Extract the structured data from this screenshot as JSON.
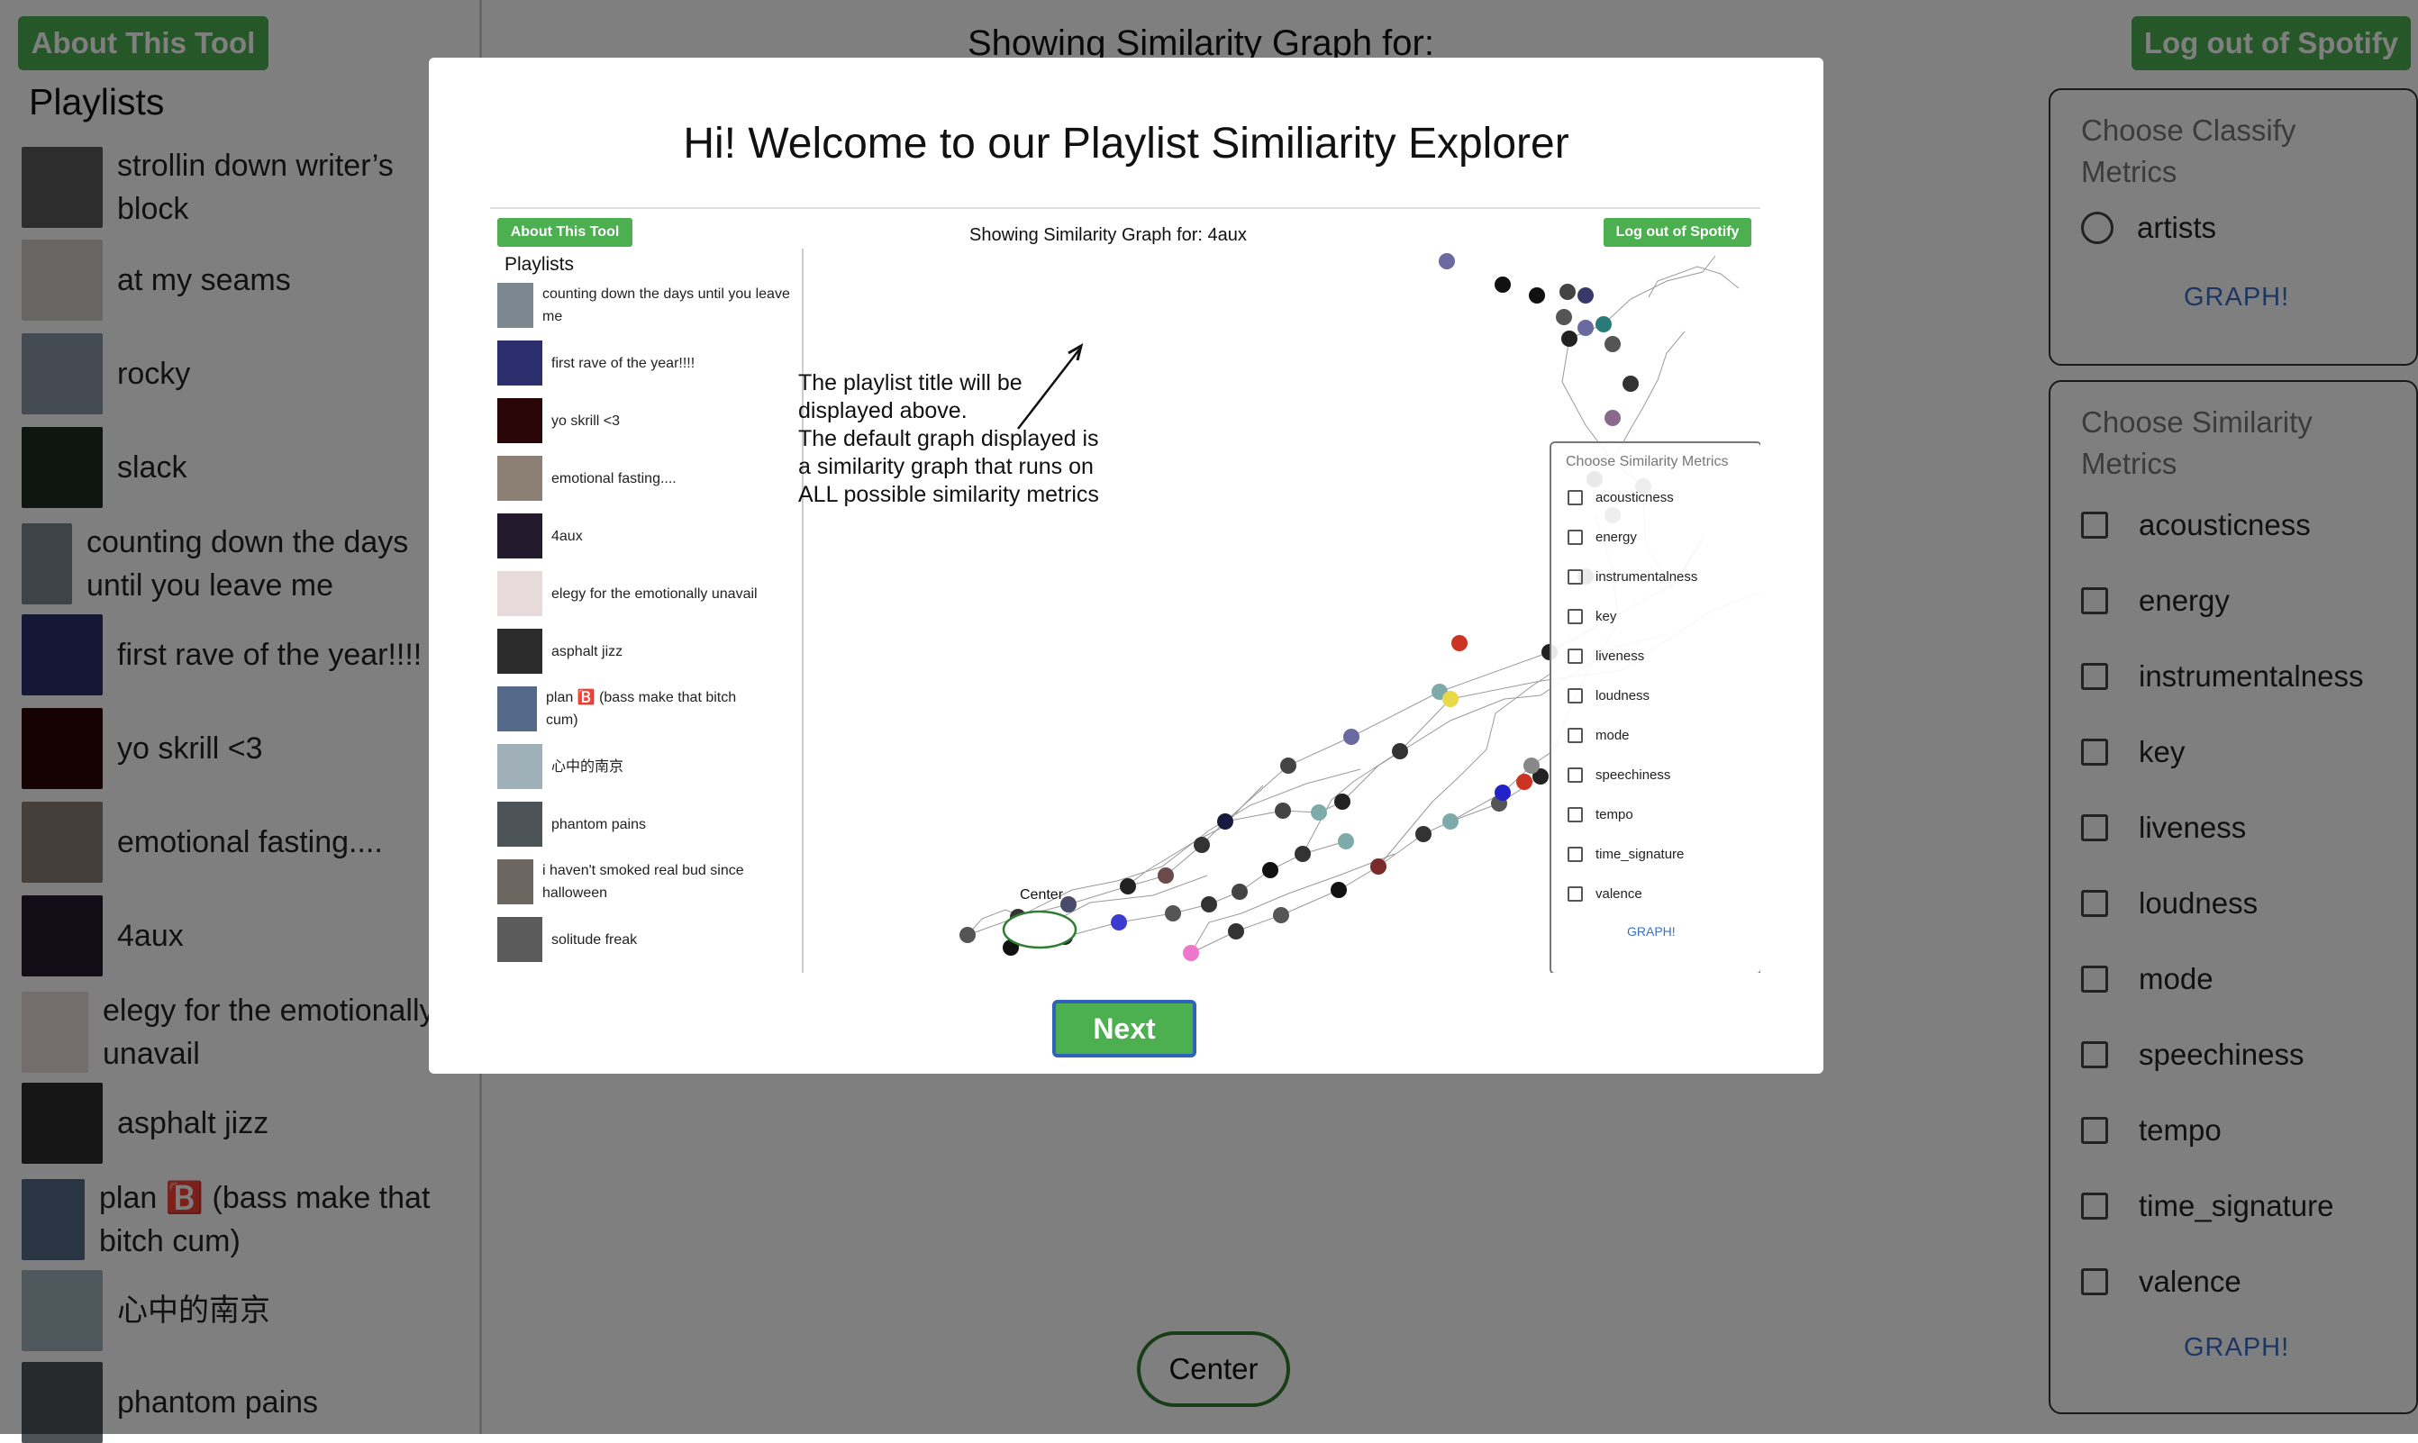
{
  "header": {
    "about_label": "About This Tool",
    "logout_label": "Log out of Spotify",
    "graph_title": "Showing Similarity Graph for:"
  },
  "sidebar": {
    "heading": "Playlists",
    "items": [
      {
        "label": "strollin down writer’s block",
        "thumb": "#5a5a5a"
      },
      {
        "label": "at my seams",
        "thumb": "#cfccc4"
      },
      {
        "label": "rocky",
        "thumb": "#8a97a4"
      },
      {
        "label": "slack",
        "thumb": "#1f2a22"
      },
      {
        "label": "counting down the days until you leave me",
        "thumb": "#7b8890"
      },
      {
        "label": "first rave of the year!!!!",
        "thumb": "#2b2f6e"
      },
      {
        "label": "yo skrill <3",
        "thumb": "#2a0608"
      },
      {
        "label": "emotional fasting....",
        "thumb": "#8c7f73"
      },
      {
        "label": "4aux",
        "thumb": "#231a2e"
      },
      {
        "label": "elegy for the emotionally unavail",
        "thumb": "#e6dada"
      },
      {
        "label": "asphalt jizz",
        "thumb": "#2c2c2c"
      },
      {
        "label": "plan 🅱️ (bass make that bitch cum)",
        "thumb": "#556a88"
      },
      {
        "label": "心中的南京",
        "thumb": "#9fb0b8"
      },
      {
        "label": "phantom pains",
        "thumb": "#4c5458"
      }
    ]
  },
  "classify_panel": {
    "title": "Choose Classify Metrics",
    "option": "artists",
    "graph_label": "GRAPH!"
  },
  "similarity_panel": {
    "title": "Choose Similarity Metrics",
    "metrics": [
      "acousticness",
      "energy",
      "instrumentalness",
      "key",
      "liveness",
      "loudness",
      "mode",
      "speechiness",
      "tempo",
      "time_signature",
      "valence"
    ],
    "graph_label": "GRAPH!"
  },
  "center_label": "Center",
  "modal": {
    "title": "Hi! Welcome to our Playlist Similiarity Explorer",
    "next_label": "Next",
    "preview": {
      "about_label": "About This Tool",
      "logout_label": "Log out of Spotify",
      "graph_title": "Showing Similarity Graph for: 4aux",
      "playlists_heading": "Playlists",
      "playlists": [
        {
          "label": "counting down the days until you leave me",
          "thumb": "#7b8890"
        },
        {
          "label": "first rave of the year!!!!",
          "thumb": "#2b2f6e"
        },
        {
          "label": "yo skrill <3",
          "thumb": "#2a0608"
        },
        {
          "label": "emotional fasting....",
          "thumb": "#8c7f73"
        },
        {
          "label": "4aux",
          "thumb": "#231a2e"
        },
        {
          "label": "elegy for the emotionally unavail",
          "thumb": "#e6dada"
        },
        {
          "label": "asphalt jizz",
          "thumb": "#2c2c2c"
        },
        {
          "label": "plan 🅱️ (bass make that bitch cum)",
          "thumb": "#556a88"
        },
        {
          "label": "心中的南京",
          "thumb": "#9fb0b8"
        },
        {
          "label": "phantom pains",
          "thumb": "#4c5458"
        },
        {
          "label": "i haven't smoked real bud since halloween",
          "thumb": "#6b6660"
        },
        {
          "label": "solitude freak",
          "thumb": "#5b5b5b"
        }
      ],
      "annotation": [
        "The playlist title will be",
        "displayed above.",
        "The default graph displayed is",
        "a similarity graph that runs on",
        "ALL possible similarity metrics"
      ],
      "metrics_title": "Choose Similarity Metrics",
      "metrics": [
        "acousticness",
        "energy",
        "instrumentalness",
        "key",
        "liveness",
        "loudness",
        "mode",
        "speechiness",
        "tempo",
        "time_signature",
        "valence"
      ],
      "graph_label": "GRAPH!",
      "center_label": "Center"
    }
  },
  "colors": {
    "accent_green": "#4caf50",
    "link_blue": "#3b6fc9",
    "next_border": "#2f63b9",
    "overlay": "rgba(0,0,0,0.5)"
  }
}
